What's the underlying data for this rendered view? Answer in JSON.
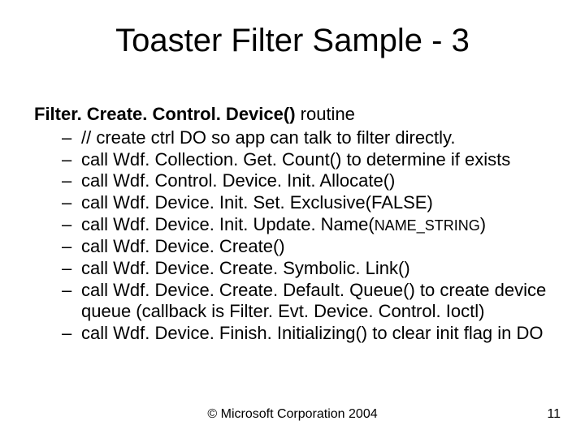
{
  "title": "Toaster Filter Sample - 3",
  "lead_bold": "Filter. Create. Control. Device()",
  "lead_rest": " routine",
  "items": [
    {
      "text": "// create ctrl DO so app can talk to filter directly."
    },
    {
      "text": "call Wdf. Collection. Get. Count() to determine if exists"
    },
    {
      "text": "call Wdf. Control. Device. Init. Allocate()"
    },
    {
      "text": "call Wdf. Device. Init. Set. Exclusive(FALSE)"
    },
    {
      "prefix": "call Wdf. Device. Init. Update. Name(",
      "small": "NAME_STRING",
      "suffix": ")"
    },
    {
      "text": "call Wdf. Device. Create()"
    },
    {
      "text": "call Wdf. Device. Create. Symbolic. Link()"
    },
    {
      "text": "call Wdf. Device. Create. Default. Queue() to create device queue (callback is Filter. Evt. Device. Control. Ioctl)"
    },
    {
      "text": "call Wdf. Device. Finish. Initializing() to clear init flag in DO"
    }
  ],
  "footer": {
    "copyright": "© Microsoft Corporation 2004",
    "page": "11"
  }
}
